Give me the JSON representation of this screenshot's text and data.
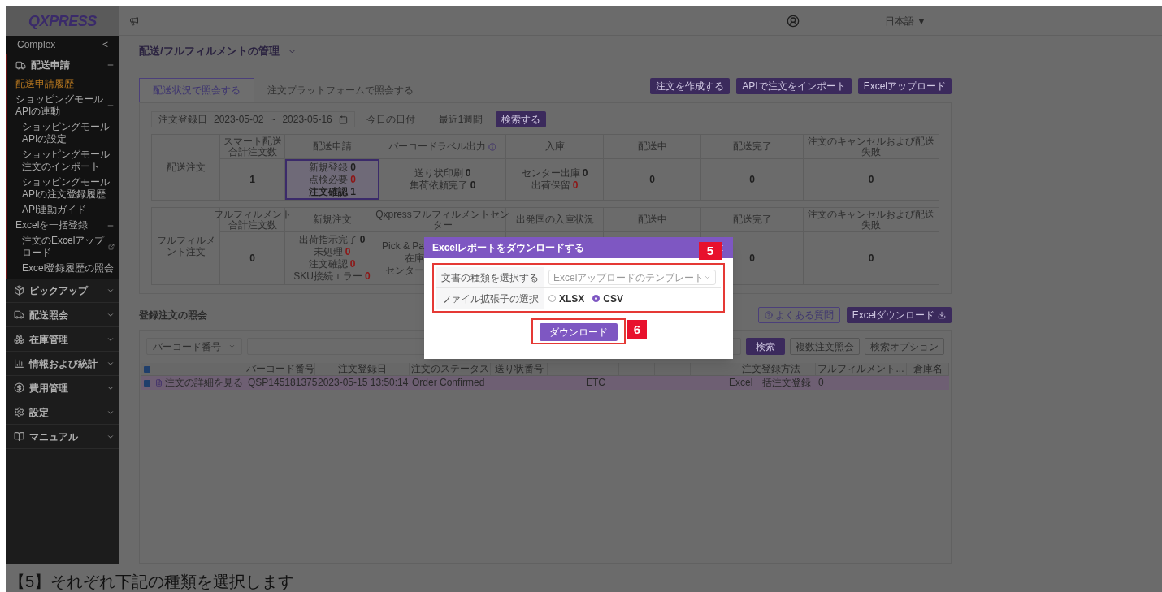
{
  "header": {
    "logo": "QXPRESS",
    "language": "日本語 ▼"
  },
  "sidebar": {
    "section": "Complex",
    "collapse": "<",
    "items": [
      {
        "label": "配送申請",
        "expanded": true,
        "children": [
          {
            "label": "配送申請履歴",
            "selected": true
          },
          {
            "label": "ショッピングモールAPIの連動",
            "expanded": true,
            "children": [
              {
                "label": "ショッピングモールAPIの設定",
                "selected": false
              },
              {
                "label": "ショッピングモール注文のインポート",
                "selected": false
              },
              {
                "label": "ショッピングモールAPIの注文登録履歴",
                "selected": false
              },
              {
                "label": "API連動ガイド",
                "selected": false
              }
            ]
          },
          {
            "label": "Excelを一括登録",
            "expanded": true,
            "children": [
              {
                "label": "注文のExcelアップロード",
                "selected": false,
                "external": true
              },
              {
                "label": "Excel登録履歴の照会",
                "selected": false
              }
            ]
          }
        ]
      },
      {
        "label": "ピックアップ",
        "expanded": false
      },
      {
        "label": "配送照会",
        "expanded": false
      },
      {
        "label": "在庫管理",
        "expanded": false
      },
      {
        "label": "情報および統計",
        "expanded": false
      },
      {
        "label": "費用管理",
        "expanded": false
      },
      {
        "label": "設定",
        "expanded": false
      },
      {
        "label": "マニュアル",
        "expanded": false
      }
    ]
  },
  "page": {
    "title": "配送/フルフィルメントの管理"
  },
  "tabs": [
    {
      "label": "配送状況で照会する",
      "selected": true
    },
    {
      "label": "注文プラットフォームで照会する",
      "selected": false
    }
  ],
  "actions": [
    "注文を作成する",
    "APIで注文をインポート",
    "Excelアップロード"
  ],
  "filter": {
    "field": "注文登録日",
    "from": "2023-05-02",
    "separator": "~",
    "to": "2023-05-16",
    "quick": [
      "今日の日付",
      "最近1週間"
    ],
    "search": "検索する"
  },
  "summary": [
    {
      "label": "配送注文",
      "columns": [
        {
          "lines": [
            "スマート配送",
            "合計注文数"
          ]
        },
        {
          "lines": [
            "配送申請"
          ]
        },
        {
          "lines": [
            "バーコードラベル出力"
          ],
          "info": true
        },
        {
          "lines": [
            "入庫"
          ]
        },
        {
          "lines": [
            "配送中"
          ]
        },
        {
          "lines": [
            "配送完了"
          ]
        },
        {
          "lines": [
            "注文のキャンセルおよび配送",
            "失敗"
          ]
        }
      ],
      "cells": [
        {
          "value": "1"
        },
        {
          "highlighted": true,
          "lines": [
            {
              "text": "新規登録",
              "value": "0",
              "alert": false
            },
            {
              "text": "点検必要",
              "value": "0",
              "alert": true
            },
            {
              "text": "注文確認",
              "value": "1",
              "alert": false
            }
          ]
        },
        {
          "highlighted": false,
          "lines": [
            {
              "text": "送り状印刷",
              "value": "0",
              "alert": false
            },
            {
              "text": "集荷依頼完了",
              "value": "0",
              "alert": false
            }
          ]
        },
        {
          "highlighted": false,
          "lines": [
            {
              "text": "センター出庫",
              "value": "0",
              "alert": false
            },
            {
              "text": "出荷保留",
              "value": "0",
              "alert": true
            }
          ]
        },
        {
          "value": "0"
        },
        {
          "value": "0"
        },
        {
          "value": "0"
        }
      ]
    },
    {
      "label": "フルフィルメント注文",
      "columns": [
        {
          "lines": [
            "フルフィルメント",
            "合計注文数"
          ]
        },
        {
          "lines": [
            "新規注文"
          ]
        },
        {
          "lines": [
            "Qxpressフルフィルメントセン",
            "ター"
          ]
        },
        {
          "lines": [
            "出発国の入庫状況"
          ]
        },
        {
          "lines": [
            "配送中"
          ]
        },
        {
          "lines": [
            "配送完了"
          ]
        },
        {
          "lines": [
            "注文のキャンセルおよび配送",
            "失敗"
          ]
        }
      ],
      "cells": [
        {
          "value": "0"
        },
        {
          "highlighted": false,
          "lines": [
            {
              "text": "出荷指示完了",
              "value": "0",
              "alert": false
            },
            {
              "text": "未処理",
              "value": "0",
              "alert": true
            },
            {
              "text": "注文確認",
              "value": "0",
              "alert": true
            },
            {
              "text": "SKU接続エラー",
              "value": "0",
              "alert": true
            }
          ]
        },
        {
          "highlighted": false,
          "lines": [
            {
              "text": "Pick & Pa"
            },
            {
              "text": "在庫"
            },
            {
              "text": "センター"
            }
          ]
        },
        null,
        null,
        {
          "value": "0"
        },
        {
          "value": "0"
        }
      ]
    }
  ],
  "orders": {
    "title": "登録注文の照会",
    "faq": "よくある質問",
    "download": "Excelダウンロード",
    "search_select": "バーコード番号",
    "search": "検索",
    "multi_search": "複数注文照会",
    "options": "検索オプション",
    "all_checked": true,
    "columns": [
      null,
      "バーコード番号",
      "注文登録日",
      "注文のステータス",
      "送り状番号",
      null,
      null,
      null,
      null,
      null,
      "注文登録方法",
      "フルフィルメント...",
      "倉庫名"
    ],
    "rows": [
      {
        "selected": true,
        "checked": true,
        "cells": [
          "注文の詳細を見る",
          "QSP145181375",
          "2023-05-15 13:50:14",
          "Order Confirmed",
          null,
          null,
          "ETC",
          null,
          null,
          null,
          "Excel一括注文登録",
          "0",
          null
        ]
      }
    ]
  },
  "modal": {
    "title": "Excelレポートをダウンロードする",
    "fields": [
      {
        "kind": "select",
        "label": "文書の種類を選択する",
        "value": "Excelアップロードのテンプレート"
      },
      {
        "kind": "radio",
        "label": "ファイル拡張子の選択",
        "options": [
          {
            "label": "XLSX",
            "selected": false
          },
          {
            "label": "CSV",
            "selected": true
          }
        ]
      }
    ],
    "button": "ダウンロード",
    "steps": [
      "5",
      "6"
    ]
  },
  "caption": "【5】それぞれ下記の種類を選択します"
}
